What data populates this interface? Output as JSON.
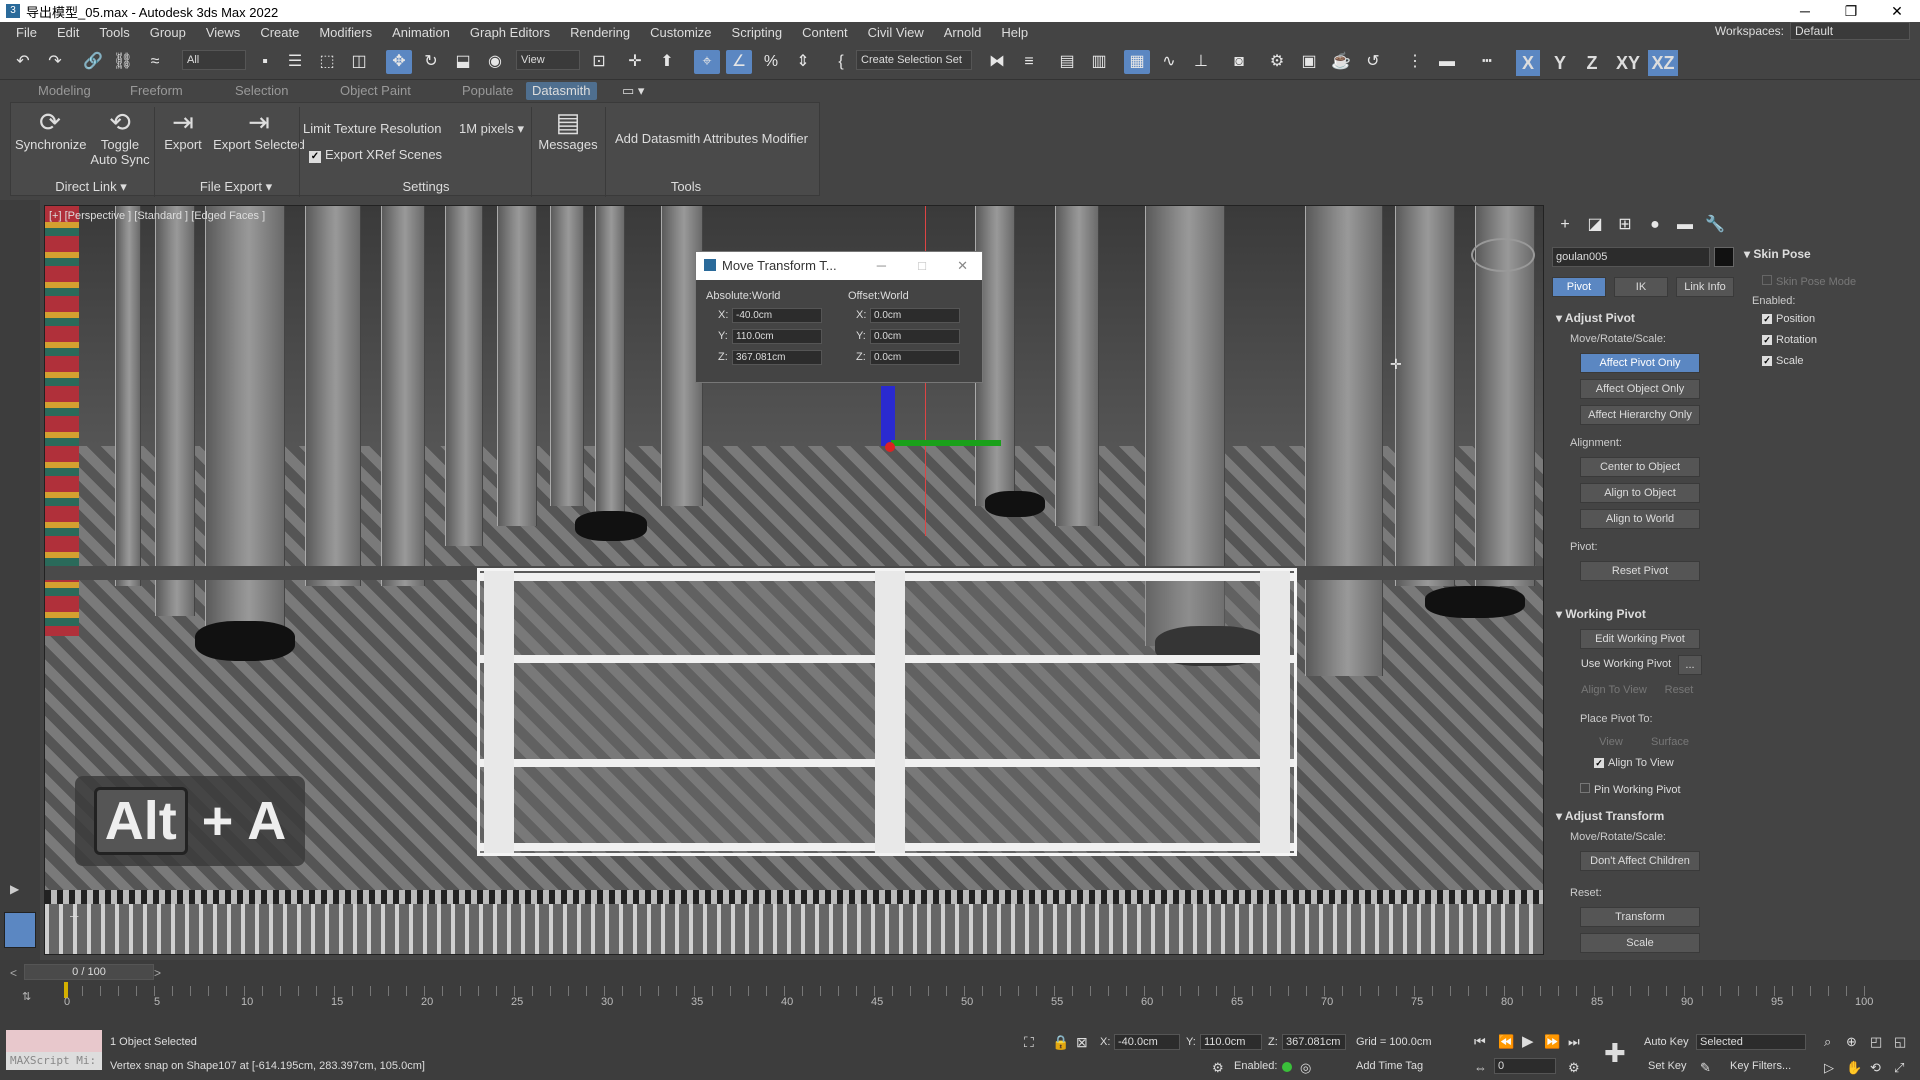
{
  "window": {
    "title": "导出模型_05.max - Autodesk 3ds Max 2022",
    "minimize": "─",
    "maximize": "❐",
    "close": "✕"
  },
  "menu": [
    "File",
    "Edit",
    "Tools",
    "Group",
    "Views",
    "Create",
    "Modifiers",
    "Animation",
    "Graph Editors",
    "Rendering",
    "Customize",
    "Scripting",
    "Content",
    "Civil View",
    "Arnold",
    "Help"
  ],
  "workspace": {
    "label": "Workspaces:",
    "value": "Default"
  },
  "toolbar": {
    "selection_filter": "All",
    "ref_coord": "View",
    "named_selection": "Create Selection Set",
    "axes": [
      "X",
      "Y",
      "Z",
      "XY",
      "XZ"
    ]
  },
  "ribbon_tabs": [
    "Modeling",
    "Freeform",
    "Selection",
    "Object Paint",
    "Populate",
    "Datasmith"
  ],
  "ribbon": {
    "synchronize": "Synchronize",
    "toggle_auto_sync": "Toggle Auto Sync",
    "export": "Export",
    "export_selected": "Export Selected",
    "limit_texture": "Limit Texture Resolution",
    "pixels": "1M pixels",
    "export_xref": "Export XRef Scenes",
    "messages": "Messages",
    "add_modifier": "Add Datasmith Attributes Modifier",
    "groups": {
      "direct_link": "Direct Link",
      "file_export": "File Export",
      "settings": "Settings",
      "tools": "Tools"
    }
  },
  "viewport": {
    "label": "[+] [Perspective ] [Standard ] [Edged Faces ]",
    "overlay_keys": [
      "Alt",
      "+",
      "A"
    ]
  },
  "move_dialog": {
    "title": "Move Transform T...",
    "absolute_label": "Absolute:World",
    "offset_label": "Offset:World",
    "abs": {
      "x": "-40.0cm",
      "y": "110.0cm",
      "z": "367.081cm"
    },
    "off": {
      "x": "0.0cm",
      "y": "0.0cm",
      "z": "0.0cm"
    }
  },
  "command_panel": {
    "object_name": "goulan005",
    "tabs": [
      "Pivot",
      "IK",
      "Link Info"
    ],
    "adjust_pivot": "Adjust Pivot",
    "move_rotate_scale": "Move/Rotate/Scale:",
    "affect_pivot_only": "Affect Pivot Only",
    "affect_object_only": "Affect Object Only",
    "affect_hierarchy_only": "Affect Hierarchy Only",
    "alignment": "Alignment:",
    "center_to_object": "Center to Object",
    "align_to_object": "Align to Object",
    "align_to_world": "Align to World",
    "pivot": "Pivot:",
    "reset_pivot": "Reset Pivot",
    "working_pivot": "Working Pivot",
    "edit_working_pivot": "Edit Working Pivot",
    "use_working_pivot": "Use Working Pivot",
    "ellipsis": "...",
    "align_to_view": "Align To View",
    "reset": "Reset",
    "place_pivot_to": "Place Pivot To:",
    "view": "View",
    "surface": "Surface",
    "align_to_view_chk": "Align To View",
    "pin_working_pivot": "Pin Working Pivot",
    "adjust_transform": "Adjust Transform",
    "move_rotate_scale2": "Move/Rotate/Scale:",
    "dont_affect_children": "Don't Affect Children",
    "reset2": "Reset:",
    "transform": "Transform",
    "scale": "Scale",
    "skin_pose": "Skin Pose",
    "skin_pose_mode": "Skin Pose Mode",
    "enabled": "Enabled:",
    "position": "Position",
    "rotation": "Rotation",
    "scale_chk": "Scale"
  },
  "timeline": {
    "frame": "0 / 100",
    "ticks": [
      "0",
      "5",
      "10",
      "15",
      "20",
      "25",
      "30",
      "35",
      "40",
      "45",
      "50",
      "55",
      "60",
      "65",
      "70",
      "75",
      "80",
      "85",
      "90",
      "95",
      "100"
    ]
  },
  "status": {
    "selected": "1 Object Selected",
    "prompt": "Vertex snap on Shape107 at [-614.195cm, 283.397cm, 105.0cm]",
    "maxscript": "MAXScript Mi:",
    "x": "-40.0cm",
    "y": "110.0cm",
    "z": "367.081cm",
    "grid": "Grid = 100.0cm",
    "enabled": "Enabled:",
    "add_time_tag": "Add Time Tag",
    "auto_key": "Auto Key",
    "selected_dd": "Selected",
    "set_key": "Set Key",
    "key_filters": "Key Filters...",
    "frame_field": "0"
  },
  "colors": {
    "accent": "#5b87c2",
    "bg": "#444444"
  }
}
